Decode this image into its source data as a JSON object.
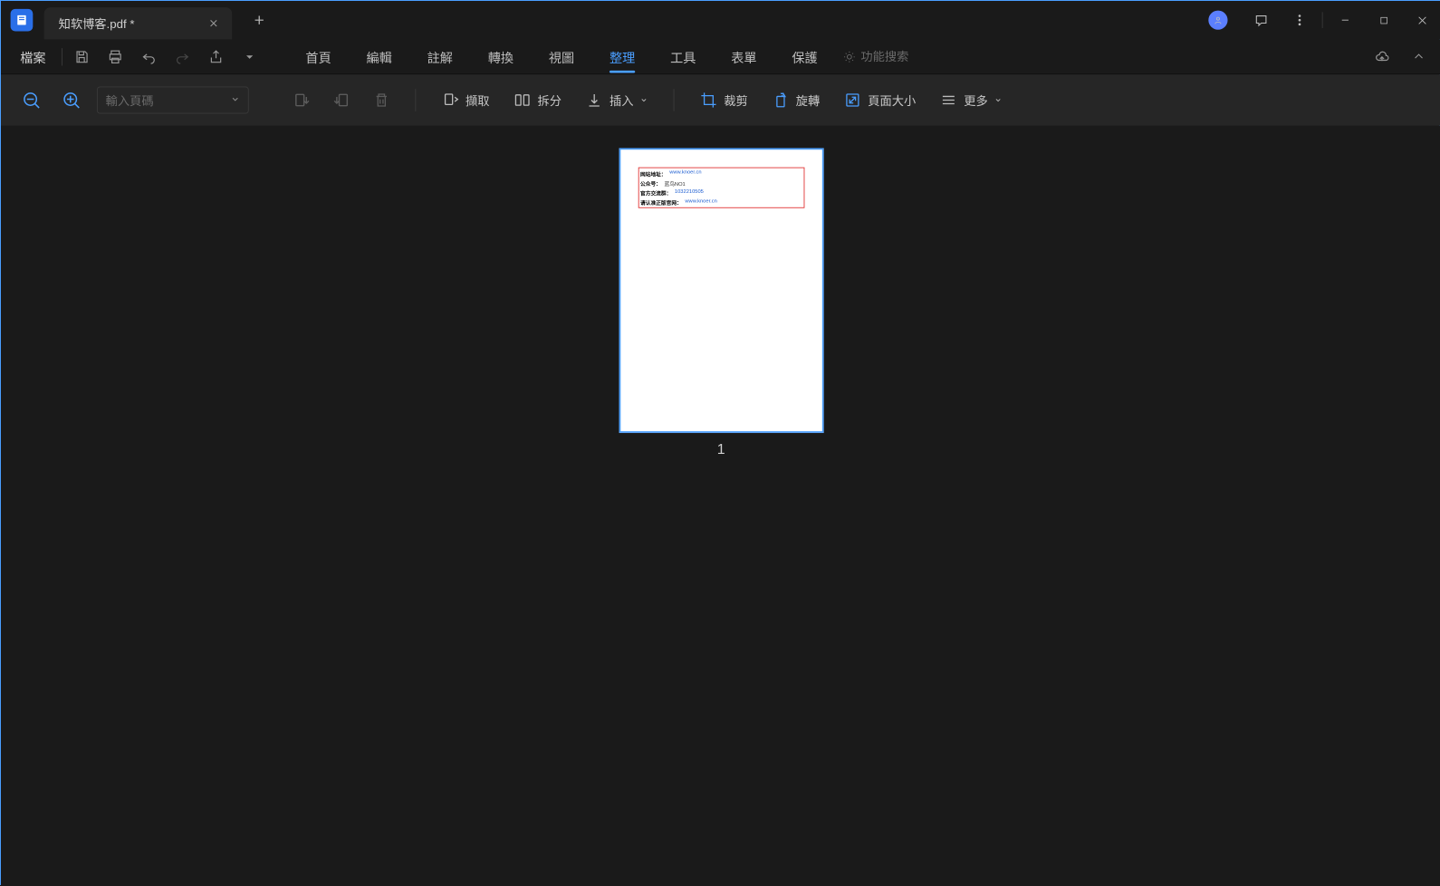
{
  "titlebar": {
    "tab_title": "知软博客.pdf *"
  },
  "menu": {
    "file": "檔案",
    "tabs": [
      "首頁",
      "編輯",
      "註解",
      "轉換",
      "視圖",
      "整理",
      "工具",
      "表單",
      "保護"
    ],
    "active_tab": "整理",
    "search_label": "功能搜索"
  },
  "toolbar": {
    "page_input_placeholder": "輸入頁碼",
    "extract": "擷取",
    "split": "拆分",
    "insert": "插入",
    "crop": "裁剪",
    "rotate": "旋轉",
    "page_size": "頁面大小",
    "more": "更多"
  },
  "document": {
    "page_number": "1",
    "content": {
      "line1_label": "网站地址：",
      "line1_value": "www.knoer.cn",
      "line2_label": "公众号：",
      "line2_value": "蓝鸟NO1",
      "line3_label": "官方交流群：",
      "line3_value": "1032210505",
      "line4_label": "请认准正版官网：",
      "line4_value": "www.knoer.cn"
    }
  }
}
